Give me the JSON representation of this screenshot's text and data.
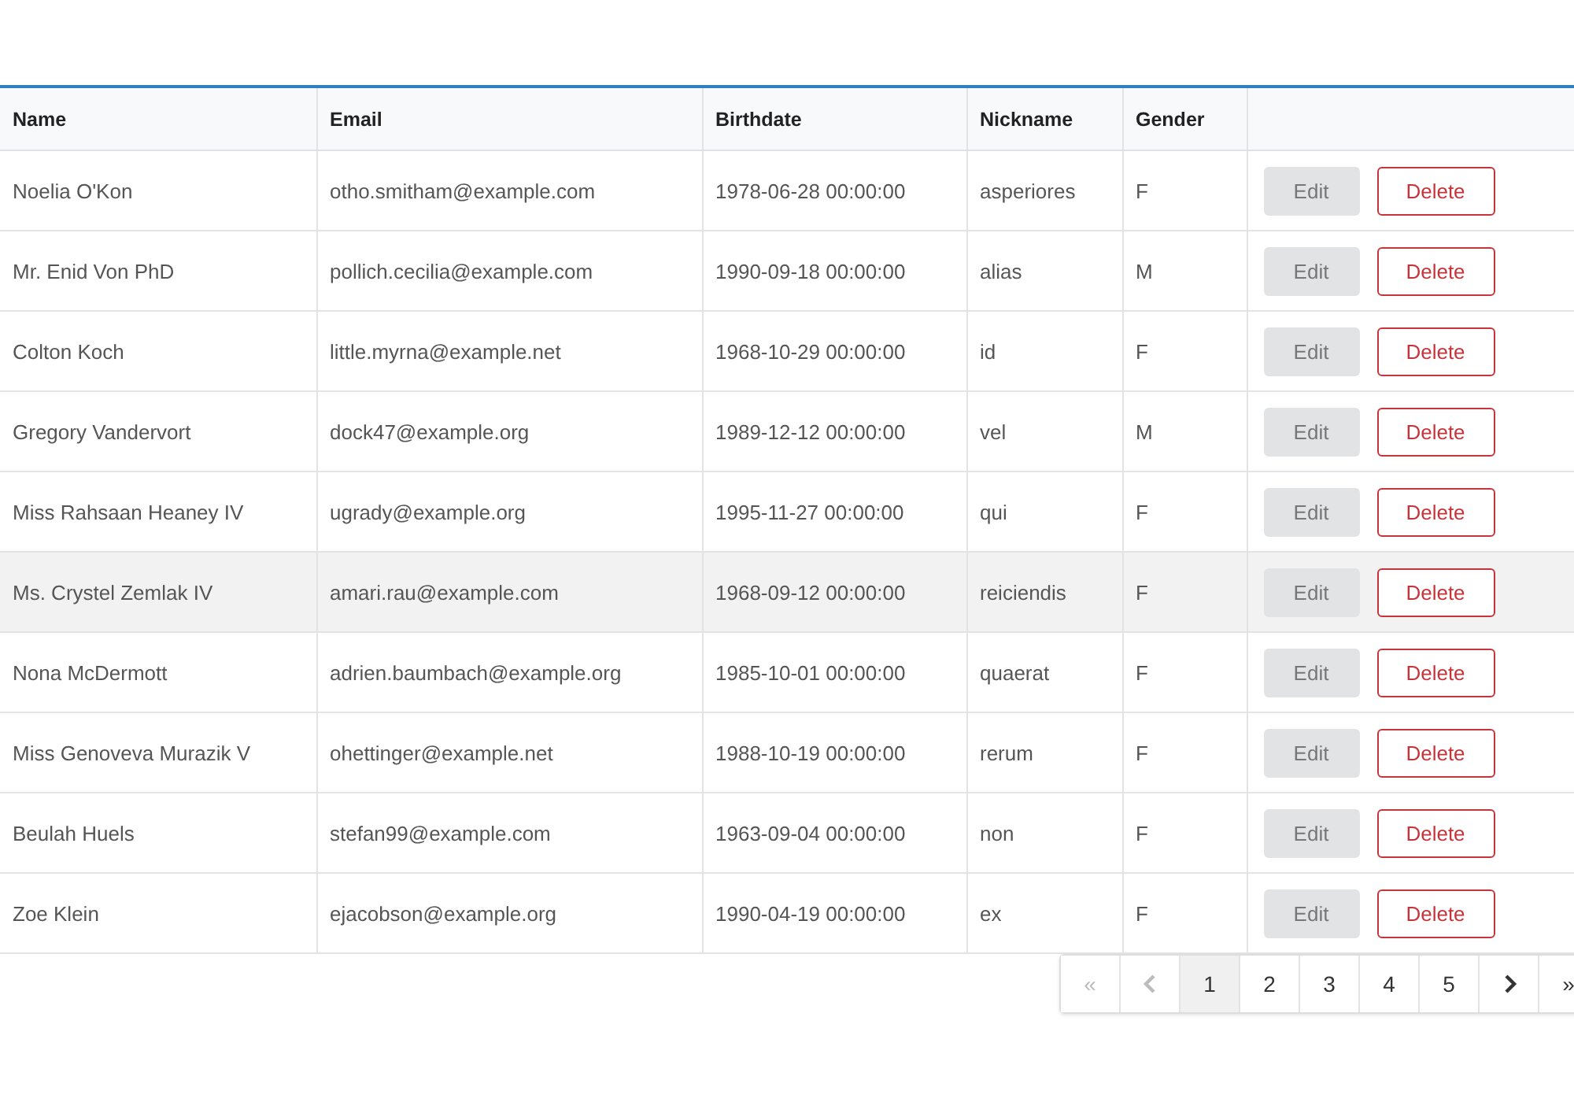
{
  "table": {
    "columns": [
      "Name",
      "Email",
      "Birthdate",
      "Nickname",
      "Gender"
    ],
    "rows": [
      {
        "cells": [
          "Noelia O'Kon",
          "otho.smitham@example.com",
          "1978-06-28 00:00:00",
          "asperiores",
          "F"
        ],
        "selected": false,
        "actions": [
          "Edit",
          "Delete"
        ]
      },
      {
        "cells": [
          "Mr. Enid Von PhD",
          "pollich.cecilia@example.com",
          "1990-09-18 00:00:00",
          "alias",
          "M"
        ],
        "selected": false,
        "actions": [
          "Edit",
          "Delete"
        ]
      },
      {
        "cells": [
          "Colton Koch",
          "little.myrna@example.net",
          "1968-10-29 00:00:00",
          "id",
          "F"
        ],
        "selected": false,
        "actions": [
          "Edit",
          "Delete"
        ]
      },
      {
        "cells": [
          "Gregory Vandervort",
          "dock47@example.org",
          "1989-12-12 00:00:00",
          "vel",
          "M"
        ],
        "selected": false,
        "actions": [
          "Edit",
          "Delete"
        ]
      },
      {
        "cells": [
          "Miss Rahsaan Heaney IV",
          "ugrady@example.org",
          "1995-11-27 00:00:00",
          "qui",
          "F"
        ],
        "selected": false,
        "actions": [
          "Edit",
          "Delete"
        ]
      },
      {
        "cells": [
          "Ms. Crystel Zemlak IV",
          "amari.rau@example.com",
          "1968-09-12 00:00:00",
          "reiciendis",
          "F"
        ],
        "selected": true,
        "actions": [
          "Edit",
          "Delete"
        ]
      },
      {
        "cells": [
          "Nona McDermott",
          "adrien.baumbach@example.org",
          "1985-10-01 00:00:00",
          "quaerat",
          "F"
        ],
        "selected": false,
        "actions": [
          "Edit",
          "Delete"
        ]
      },
      {
        "cells": [
          "Miss Genoveva Murazik V",
          "ohettinger@example.net",
          "1988-10-19 00:00:00",
          "rerum",
          "F"
        ],
        "selected": false,
        "actions": [
          "Edit",
          "Delete"
        ]
      },
      {
        "cells": [
          "Beulah Huels",
          "stefan99@example.com",
          "1963-09-04 00:00:00",
          "non",
          "F"
        ],
        "selected": false,
        "actions": [
          "Edit",
          "Delete"
        ]
      },
      {
        "cells": [
          "Zoe Klein",
          "ejacobson@example.org",
          "1990-04-19 00:00:00",
          "ex",
          "F"
        ],
        "selected": false,
        "actions": [
          "Edit",
          "Delete"
        ]
      }
    ]
  },
  "pagination": [
    {
      "kind": "first",
      "label": "«",
      "disabled": true,
      "selected": false
    },
    {
      "kind": "prev",
      "disabled": true,
      "selected": false
    },
    {
      "kind": "page",
      "label": "1",
      "disabled": false,
      "selected": true
    },
    {
      "kind": "page",
      "label": "2",
      "disabled": false,
      "selected": false
    },
    {
      "kind": "page",
      "label": "3",
      "disabled": false,
      "selected": false
    },
    {
      "kind": "page",
      "label": "4",
      "disabled": false,
      "selected": false
    },
    {
      "kind": "page",
      "label": "5",
      "disabled": false,
      "selected": false
    },
    {
      "kind": "next",
      "disabled": false,
      "selected": false
    },
    {
      "kind": "last",
      "label": "»",
      "disabled": false,
      "selected": false
    }
  ]
}
